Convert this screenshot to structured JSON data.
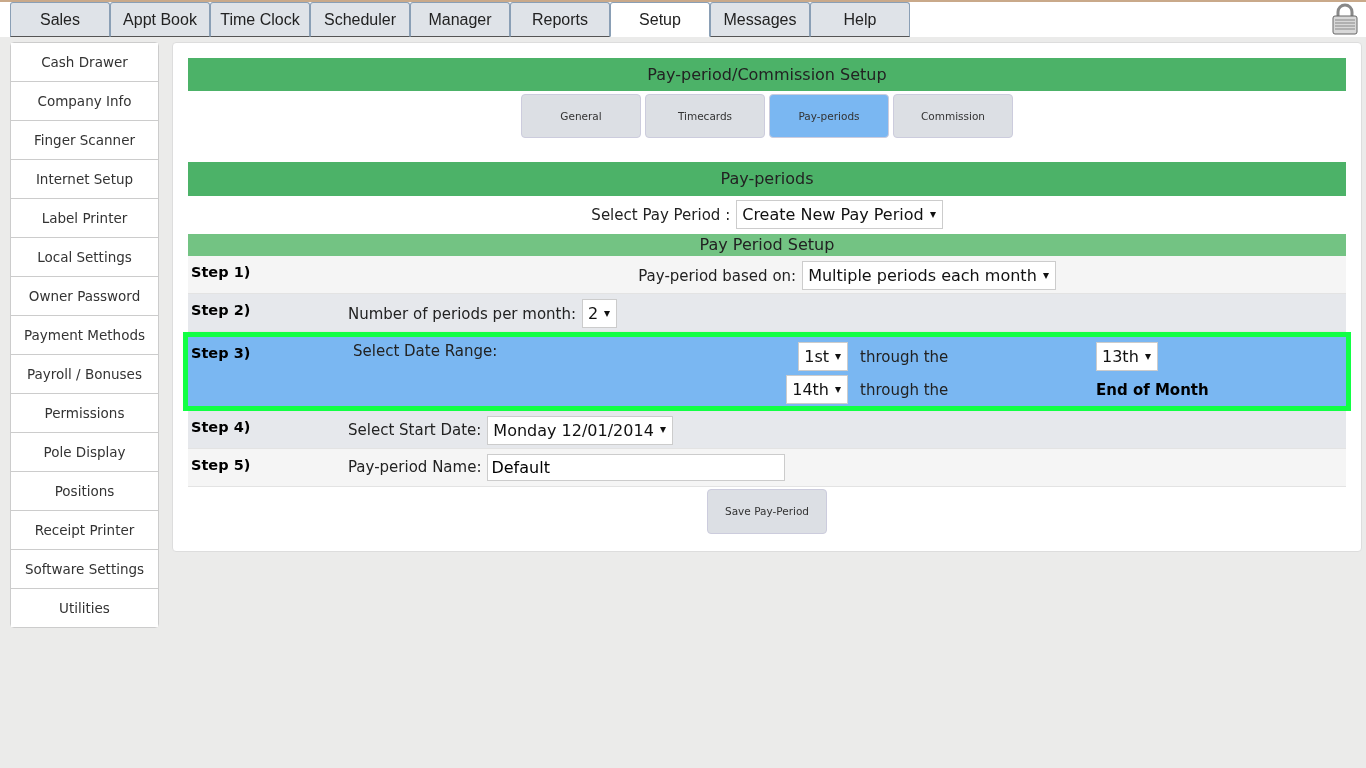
{
  "top_tabs": [
    {
      "label": "Sales",
      "selected": false
    },
    {
      "label": "Appt Book",
      "selected": false
    },
    {
      "label": "Time Clock",
      "selected": false
    },
    {
      "label": "Scheduler",
      "selected": false
    },
    {
      "label": "Manager",
      "selected": false
    },
    {
      "label": "Reports",
      "selected": false
    },
    {
      "label": "Setup",
      "selected": true
    },
    {
      "label": "Messages",
      "selected": false
    },
    {
      "label": "Help",
      "selected": false
    }
  ],
  "sidebar": {
    "items": [
      {
        "label": "Cash Drawer"
      },
      {
        "label": "Company Info"
      },
      {
        "label": "Finger Scanner"
      },
      {
        "label": "Internet Setup"
      },
      {
        "label": "Label Printer"
      },
      {
        "label": "Local Settings"
      },
      {
        "label": "Owner Password"
      },
      {
        "label": "Payment Methods"
      },
      {
        "label": "Payroll / Bonuses"
      },
      {
        "label": "Permissions"
      },
      {
        "label": "Pole Display"
      },
      {
        "label": "Positions"
      },
      {
        "label": "Receipt Printer"
      },
      {
        "label": "Software Settings"
      },
      {
        "label": "Utilities"
      }
    ]
  },
  "header": "Pay-period/Commission Setup",
  "sub_tabs": [
    {
      "label": "General",
      "selected": false
    },
    {
      "label": "Timecards",
      "selected": false
    },
    {
      "label": "Pay-periods",
      "selected": true
    },
    {
      "label": "Commission",
      "selected": false
    }
  ],
  "section_title": "Pay-periods",
  "select_pay_period": {
    "label": "Select Pay Period :",
    "value": "Create New Pay Period"
  },
  "setup_title": "Pay Period Setup",
  "steps": [
    {
      "step": "Step 1)",
      "kind": "center",
      "highlighted": false,
      "label": "Pay-period based on:",
      "value": "Multiple periods each month"
    },
    {
      "step": "Step 2)",
      "kind": "select",
      "highlighted": false,
      "label": "Number of periods per month:",
      "value": "2"
    },
    {
      "step": "Step 3)",
      "kind": "ranges",
      "highlighted": true,
      "label": "Select Date Range:",
      "ranges": [
        {
          "start": "1st",
          "through": "through the",
          "end": {
            "kind": "select",
            "value": "13th"
          }
        },
        {
          "start": "14th",
          "through": "through the",
          "end": {
            "kind": "text",
            "value": "End of Month"
          }
        }
      ]
    },
    {
      "step": "Step 4)",
      "kind": "select",
      "highlighted": false,
      "label": "Select Start Date:",
      "value": "Monday 12/01/2014"
    },
    {
      "step": "Step 5)",
      "kind": "input",
      "highlighted": false,
      "label": "Pay-period Name:",
      "value": "Default"
    }
  ],
  "save_button": "Save Pay-Period"
}
